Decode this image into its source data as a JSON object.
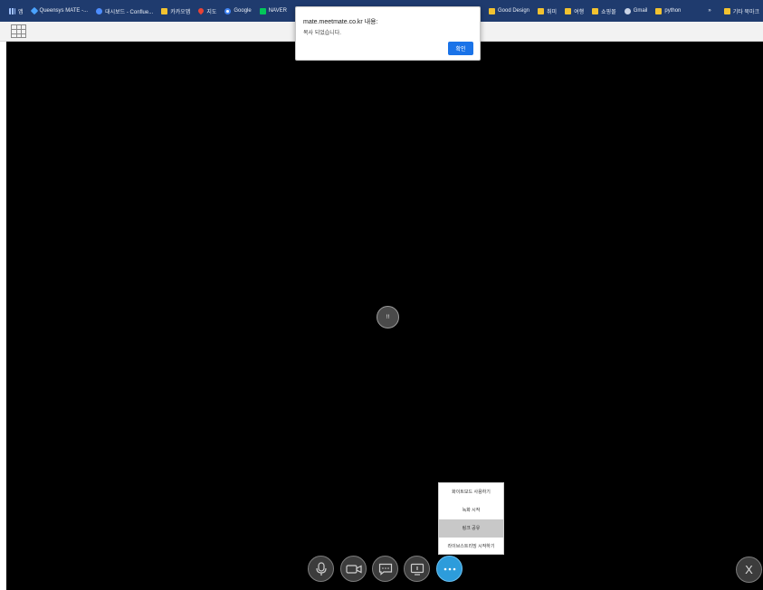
{
  "bookmarks": {
    "items": [
      {
        "label": "앱",
        "icon": "apps-icon"
      },
      {
        "label": "Queensys MATE -...",
        "icon": "diamond-icon"
      },
      {
        "label": "대시보드 - Conflue...",
        "icon": "confluence-icon"
      },
      {
        "label": "카카오맵",
        "icon": "kakaomap-icon"
      },
      {
        "label": "지도",
        "icon": "map-pin-icon"
      },
      {
        "label": "Google",
        "icon": "google-icon"
      },
      {
        "label": "NAVER",
        "icon": "naver-icon"
      }
    ],
    "right_items": [
      {
        "label": "Good Design",
        "icon": "folder-icon"
      },
      {
        "label": "취미",
        "icon": "folder-icon"
      },
      {
        "label": "여행",
        "icon": "folder-icon"
      },
      {
        "label": "쇼핑몰",
        "icon": "folder-icon"
      },
      {
        "label": "Gmail",
        "icon": "globe-icon"
      },
      {
        "label": "python",
        "icon": "folder-icon"
      }
    ],
    "overflow": "»",
    "other": "기타 북마크"
  },
  "alert": {
    "title": "mate.meetmate.co.kr 내용:",
    "message": "복사 되었습니다.",
    "ok_label": "확인"
  },
  "spinner": {
    "label": "!!"
  },
  "more_menu": {
    "items": [
      {
        "label": "화이트보드 사용하기",
        "active": false
      },
      {
        "label": "녹화 시작",
        "active": false
      },
      {
        "label": "링크 공유",
        "active": true
      },
      {
        "label": "라이브스트리밍 시작하기",
        "active": false
      }
    ]
  },
  "controls": {
    "buttons": [
      {
        "name": "mic",
        "icon": "microphone-icon"
      },
      {
        "name": "camera",
        "icon": "video-camera-icon"
      },
      {
        "name": "chat",
        "icon": "chat-icon"
      },
      {
        "name": "screen-share",
        "icon": "screen-share-icon"
      },
      {
        "name": "more",
        "icon": "more-dots-icon"
      }
    ],
    "leave_label": "X"
  },
  "colors": {
    "bookmark_bar": "#1f3b6e",
    "stage": "#000000",
    "accent": "#2d9cdb",
    "alert_button": "#1a73e8"
  }
}
